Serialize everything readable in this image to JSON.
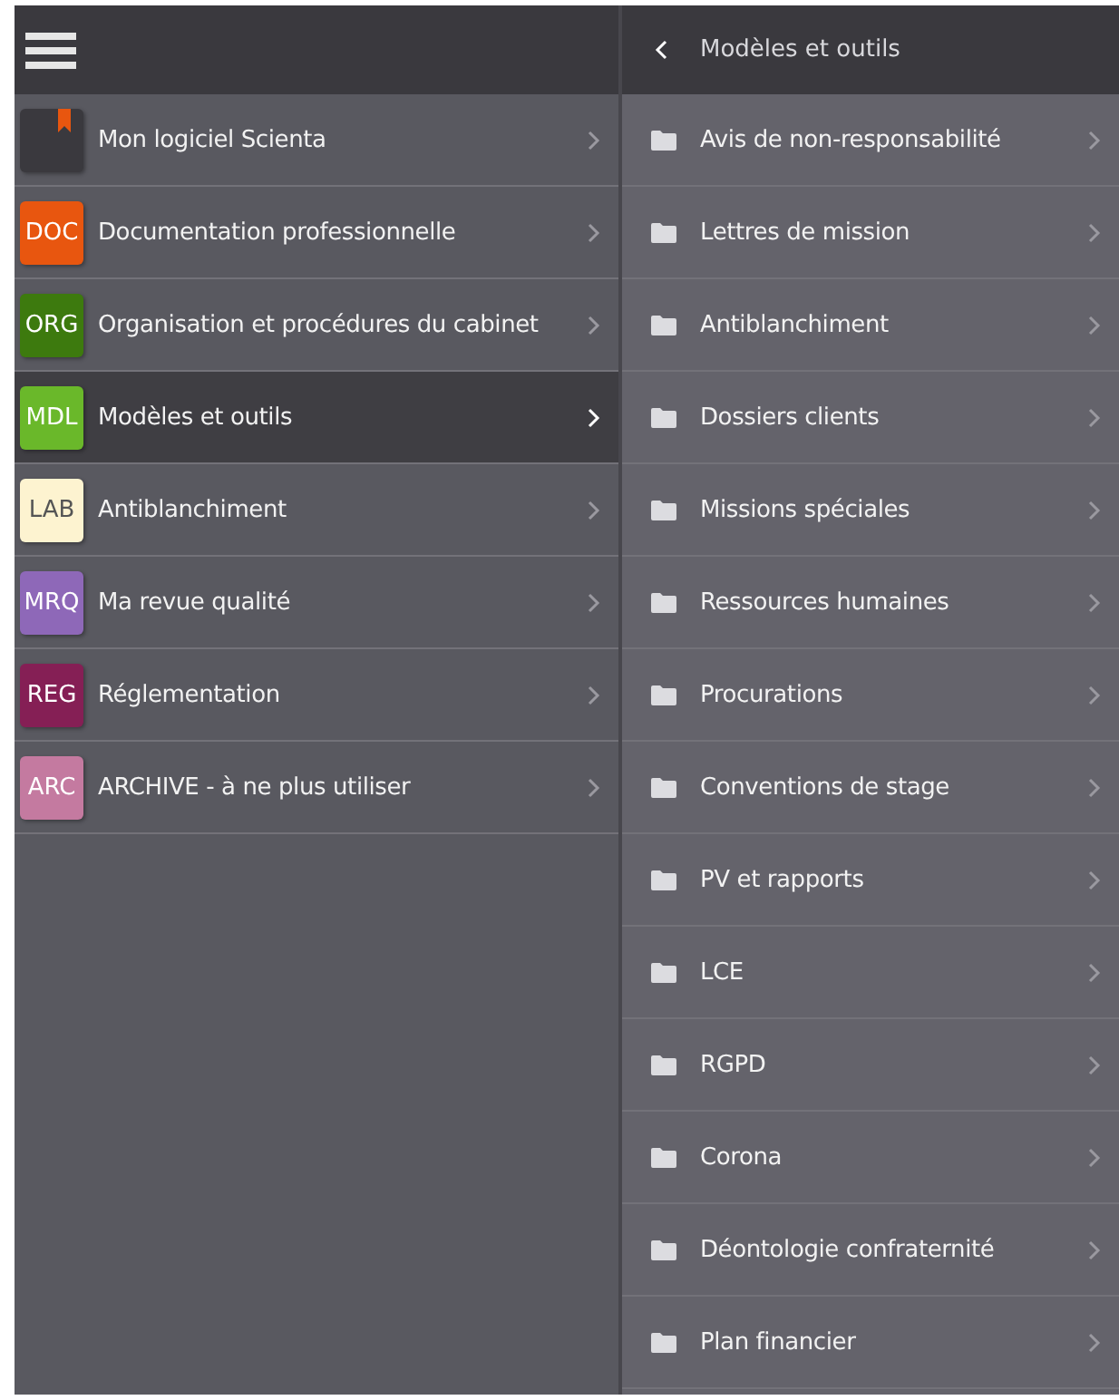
{
  "left_panel": {
    "items": [
      {
        "kind": "icon",
        "label": "Mon logiciel Scienta",
        "color": "#3a393e",
        "selected": false
      },
      {
        "kind": "code",
        "code": "DOC",
        "label": "Documentation professionnelle",
        "color": "#e8560f",
        "selected": false
      },
      {
        "kind": "code",
        "code": "ORG",
        "label": "Organisation et procédures du cabinet",
        "color": "#3d7a0e",
        "selected": false
      },
      {
        "kind": "code",
        "code": "MDL",
        "label": "Modèles et outils",
        "color": "#6ab82a",
        "selected": true
      },
      {
        "kind": "code",
        "code": "LAB",
        "label": "Antiblanchiment",
        "color": "#fdf3d0",
        "selected": false
      },
      {
        "kind": "code",
        "code": "MRQ",
        "label": "Ma revue qualité",
        "color": "#8e68b8",
        "selected": false
      },
      {
        "kind": "code",
        "code": "REG",
        "label": "Réglementation",
        "color": "#851f55",
        "selected": false
      },
      {
        "kind": "code",
        "code": "ARC",
        "label": "ARCHIVE - à ne plus utiliser",
        "color": "#c47aa0",
        "selected": false
      }
    ]
  },
  "right_panel": {
    "title": "Modèles et outils",
    "items": [
      "Avis de non-responsabilité",
      "Lettres de mission",
      "Antiblanchiment",
      "Dossiers clients",
      "Missions spéciales",
      "Ressources humaines",
      "Procurations",
      "Conventions de stage",
      "PV et rapports",
      "LCE",
      "RGPD",
      "Corona",
      "Déontologie confraternité",
      "Plan financier"
    ]
  }
}
